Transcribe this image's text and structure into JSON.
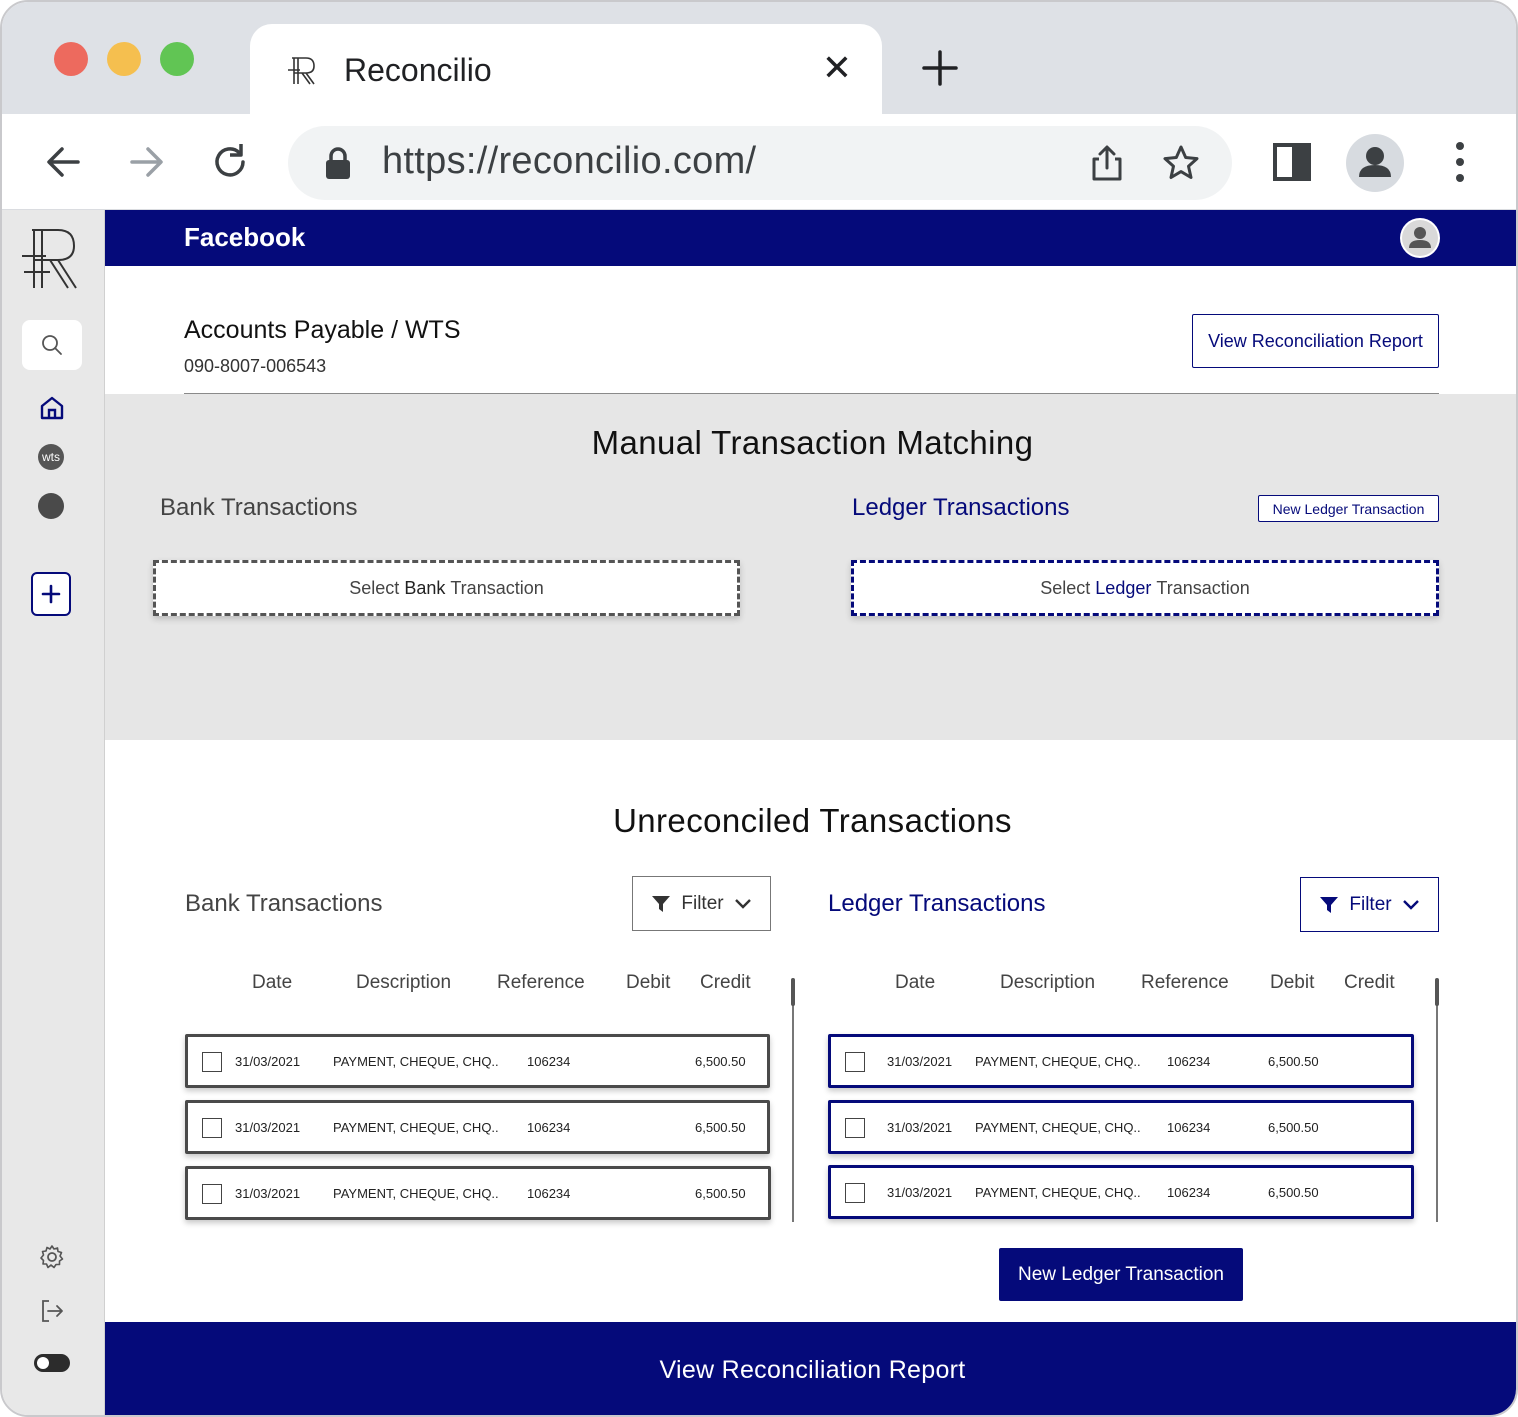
{
  "browser": {
    "tab_title": "Reconcilio",
    "url": "https://reconcilio.com/"
  },
  "sidebar": {
    "items": [
      {
        "name": "search",
        "icon": "search-icon"
      },
      {
        "name": "home",
        "icon": "home-icon"
      },
      {
        "name": "wts",
        "label": "wts"
      },
      {
        "name": "account-circle",
        "icon": "circle-icon"
      },
      {
        "name": "add",
        "icon": "plus-icon"
      },
      {
        "name": "settings",
        "icon": "gear-icon"
      },
      {
        "name": "logout",
        "icon": "logout-icon"
      },
      {
        "name": "theme-toggle",
        "icon": "toggle-icon"
      }
    ]
  },
  "header": {
    "company": "Facebook"
  },
  "account": {
    "title": "Accounts Payable / WTS",
    "number": "090-8007-006543",
    "report_button": "View Reconciliation Report"
  },
  "matching": {
    "title": "Manual Transaction Matching",
    "bank_title": "Bank Transactions",
    "ledger_title": "Ledger Transactions",
    "new_ledger_button": "New Ledger Transaction",
    "bank_placeholder_prefix": "Select ",
    "bank_placeholder_word": "Bank",
    "bank_placeholder_suffix": " Transaction",
    "ledger_placeholder_prefix": "Select ",
    "ledger_placeholder_word": "Ledger",
    "ledger_placeholder_suffix": " Transaction"
  },
  "unreconciled": {
    "title": "Unreconciled Transactions",
    "bank_title": "Bank Transactions",
    "ledger_title": "Ledger Transactions",
    "filter_label": "Filter",
    "columns": [
      "Date",
      "Description",
      "Reference",
      "Debit",
      "Credit"
    ],
    "bank_rows": [
      {
        "date": "31/03/2021",
        "description": "PAYMENT, CHEQUE, CHQ..",
        "reference": "106234",
        "debit": "",
        "credit": "6,500.50"
      },
      {
        "date": "31/03/2021",
        "description": "PAYMENT, CHEQUE, CHQ..",
        "reference": "106234",
        "debit": "",
        "credit": "6,500.50"
      },
      {
        "date": "31/03/2021",
        "description": "PAYMENT, CHEQUE, CHQ..",
        "reference": "106234",
        "debit": "",
        "credit": "6,500.50"
      }
    ],
    "ledger_rows": [
      {
        "date": "31/03/2021",
        "description": "PAYMENT, CHEQUE, CHQ..",
        "reference": "106234",
        "debit": "6,500.50",
        "credit": ""
      },
      {
        "date": "31/03/2021",
        "description": "PAYMENT, CHEQUE, CHQ..",
        "reference": "106234",
        "debit": "6,500.50",
        "credit": ""
      },
      {
        "date": "31/03/2021",
        "description": "PAYMENT, CHEQUE, CHQ..",
        "reference": "106234",
        "debit": "6,500.50",
        "credit": ""
      }
    ],
    "new_ledger_button": "New Ledger Transaction"
  },
  "footer": {
    "report_button": "View Reconciliation Report"
  },
  "colors": {
    "brand_navy": "#050a7a",
    "panel_grey": "#e6e6e6",
    "sidebar_grey": "#e8e8e8"
  }
}
